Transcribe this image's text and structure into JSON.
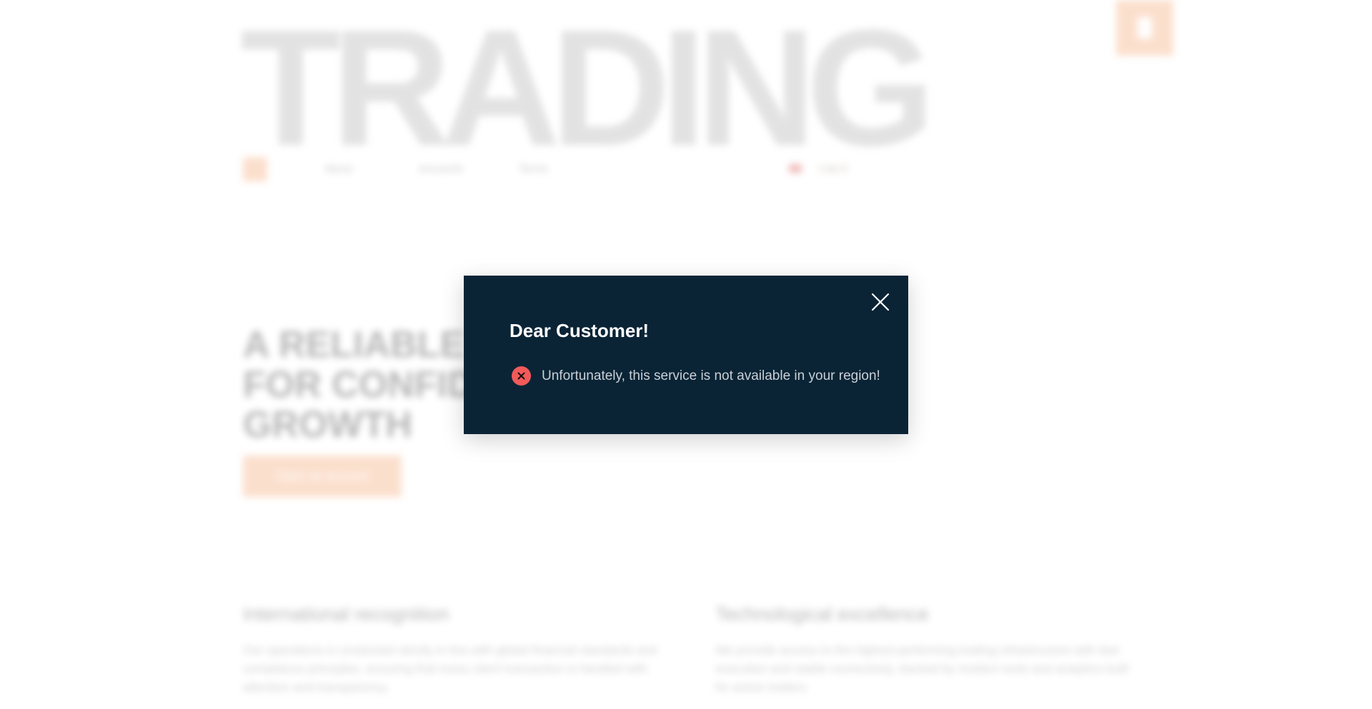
{
  "background": {
    "hero_word": "TRADING",
    "nav": {
      "items": [
        "About",
        "Accounts",
        "Terms"
      ],
      "login_label": "Log in"
    },
    "hero": {
      "title_lines": [
        "A RELIABLE BROKER",
        "FOR CONFIDENT",
        "GROWTH"
      ],
      "button_label": "Open an account"
    },
    "features": [
      {
        "title": "International recognition",
        "text": "Our operations is conducted strictly in line with global financial standards and compliance principles, ensuring that every client transaction is handled with attention and transparency."
      },
      {
        "title": "Technological excellence",
        "text": "We provide access to the highest-performing trading infrastructure with fast execution and stable connectivity, backed by modern tools and analytics built for active traders."
      }
    ]
  },
  "modal": {
    "title": "Dear Customer!",
    "message": "Unfortunately, this service is not available in your region!",
    "close_icon": "close-icon",
    "error_icon": "error-circle-icon"
  },
  "colors": {
    "modal_bg": "#0a2436",
    "error": "#f25a5a",
    "accent": "#f7b58a"
  }
}
